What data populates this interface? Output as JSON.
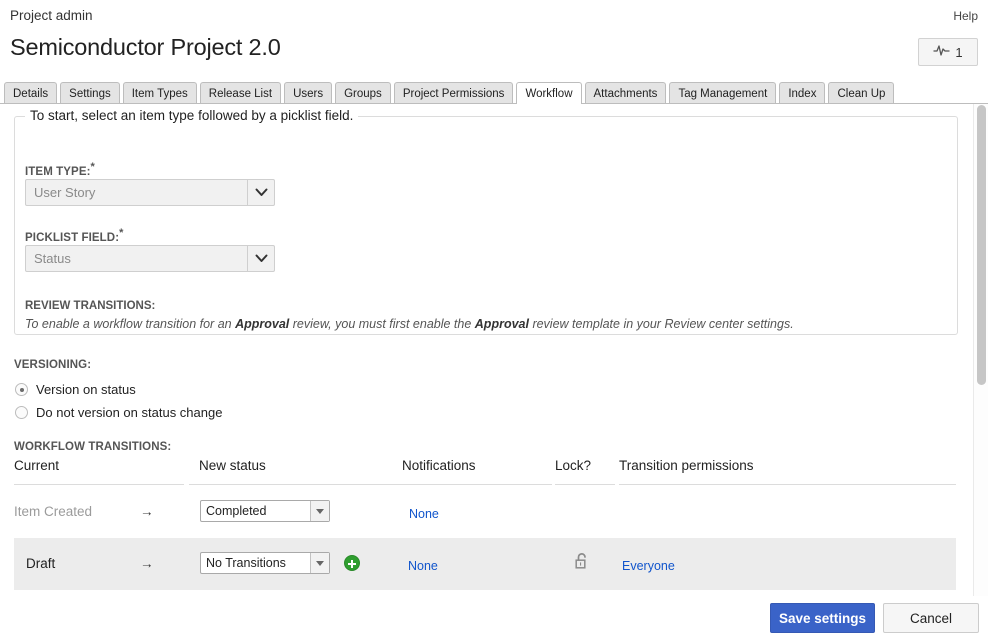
{
  "header": {
    "breadcrumb": "Project admin",
    "help_label": "Help",
    "title": "Semiconductor Project 2.0",
    "activity_icon": "pulse-icon",
    "activity_count": "1"
  },
  "tabs": [
    {
      "label": "Details",
      "active": false
    },
    {
      "label": "Settings",
      "active": false
    },
    {
      "label": "Item Types",
      "active": false
    },
    {
      "label": "Release List",
      "active": false
    },
    {
      "label": "Users",
      "active": false
    },
    {
      "label": "Groups",
      "active": false
    },
    {
      "label": "Project Permissions",
      "active": false
    },
    {
      "label": "Workflow",
      "active": true
    },
    {
      "label": "Attachments",
      "active": false
    },
    {
      "label": "Tag Management",
      "active": false
    },
    {
      "label": "Index",
      "active": false
    },
    {
      "label": "Clean Up",
      "active": false
    }
  ],
  "start_panel": {
    "legend": "To start, select an item type followed by a picklist field.",
    "item_type_label": "ITEM TYPE:",
    "item_type_required": "*",
    "item_type_value": "User Story",
    "picklist_label": "PICKLIST FIELD:",
    "picklist_required": "*",
    "picklist_value": "Status",
    "review_heading": "REVIEW TRANSITIONS:",
    "review_note_a": "To enable a workflow transition for an ",
    "review_note_b": "Approval",
    "review_note_c": " review, you must first enable the ",
    "review_note_d": "Approval",
    "review_note_e": " review template in your Review center settings."
  },
  "versioning": {
    "heading": "VERSIONING:",
    "options": [
      {
        "label": "Version on status",
        "selected": true
      },
      {
        "label": "Do not version on status change",
        "selected": false
      }
    ]
  },
  "transitions": {
    "heading": "WORKFLOW TRANSITIONS:",
    "columns": {
      "current": "Current",
      "new_status": "New status",
      "notifications": "Notifications",
      "lock": "Lock?",
      "permissions": "Transition permissions"
    },
    "rows": [
      {
        "current": "Item Created",
        "arrow": "→",
        "new_status": "Completed",
        "has_add": false,
        "notifications": "None",
        "lock_icon": "",
        "permissions": ""
      },
      {
        "current": "Draft",
        "arrow": "→",
        "new_status": "No Transitions",
        "has_add": true,
        "notifications": "None",
        "lock_icon": "unlock-icon",
        "permissions": "Everyone"
      }
    ]
  },
  "footer": {
    "save_label": "Save settings",
    "cancel_label": "Cancel"
  },
  "colors": {
    "accent_blue": "#3a63c8",
    "link_blue": "#1155cc",
    "add_green": "#2f9e2f",
    "alt_row": "#ececec"
  }
}
